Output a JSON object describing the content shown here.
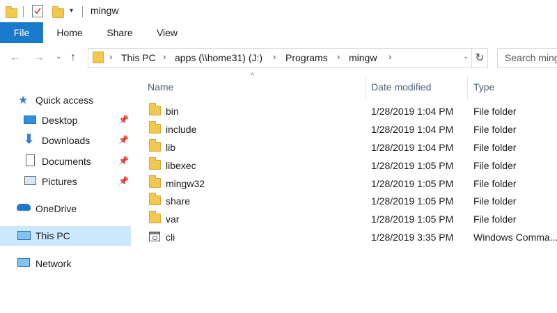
{
  "window": {
    "title": "mingw"
  },
  "quick_access_toolbar": {
    "icons": [
      "folder-icon",
      "properties-icon",
      "new-folder-icon",
      "customize-dropdown-icon"
    ]
  },
  "ribbon": {
    "tabs": [
      {
        "label": "File",
        "active": true
      },
      {
        "label": "Home"
      },
      {
        "label": "Share"
      },
      {
        "label": "View"
      }
    ]
  },
  "address_bar": {
    "breadcrumbs": [
      "This PC",
      "apps (\\\\home31) (J:)",
      "Programs",
      "mingw"
    ]
  },
  "search": {
    "placeholder": "Search ming"
  },
  "nav_pane": {
    "items": [
      {
        "label": "Quick access",
        "icon": "star-icon"
      },
      {
        "label": "Desktop",
        "icon": "desktop-icon",
        "pinned": true
      },
      {
        "label": "Downloads",
        "icon": "downloads-icon",
        "pinned": true
      },
      {
        "label": "Documents",
        "icon": "documents-icon",
        "pinned": true
      },
      {
        "label": "Pictures",
        "icon": "pictures-icon",
        "pinned": true
      },
      {
        "label": "OneDrive",
        "icon": "cloud-icon"
      },
      {
        "label": "This PC",
        "icon": "computer-icon",
        "selected": true
      },
      {
        "label": "Network",
        "icon": "network-icon"
      }
    ]
  },
  "file_list": {
    "columns": [
      "Name",
      "Date modified",
      "Type"
    ],
    "sorted_by": "Name",
    "rows": [
      {
        "name": "bin",
        "date": "1/28/2019 1:04 PM",
        "type": "File folder",
        "icon": "folder-icon"
      },
      {
        "name": "include",
        "date": "1/28/2019 1:04 PM",
        "type": "File folder",
        "icon": "folder-icon"
      },
      {
        "name": "lib",
        "date": "1/28/2019 1:04 PM",
        "type": "File folder",
        "icon": "folder-icon"
      },
      {
        "name": "libexec",
        "date": "1/28/2019 1:05 PM",
        "type": "File folder",
        "icon": "folder-icon"
      },
      {
        "name": "mingw32",
        "date": "1/28/2019 1:05 PM",
        "type": "File folder",
        "icon": "folder-icon"
      },
      {
        "name": "share",
        "date": "1/28/2019 1:05 PM",
        "type": "File folder",
        "icon": "folder-icon"
      },
      {
        "name": "var",
        "date": "1/28/2019 1:05 PM",
        "type": "File folder",
        "icon": "folder-icon"
      },
      {
        "name": "cli",
        "date": "1/28/2019 3:35 PM",
        "type": "Windows Comma...",
        "icon": "command-script-icon"
      }
    ]
  },
  "colors": {
    "file_tab": "#1979ca",
    "selection": "#cce8ff",
    "folder": "#f3c84e",
    "column_header": "#4c607a"
  }
}
